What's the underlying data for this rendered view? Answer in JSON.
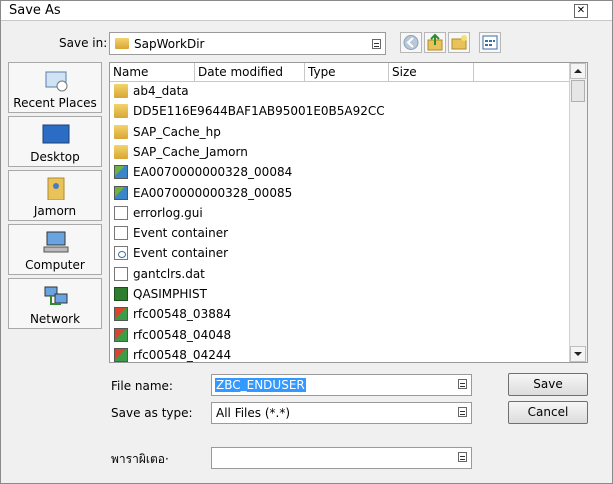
{
  "window": {
    "title": "Save As"
  },
  "save_in": {
    "label": "Save in:",
    "value": "SapWorkDir"
  },
  "toolbar": {
    "back_icon": "back-arrow-icon",
    "up_icon": "up-folder-icon",
    "new_folder_icon": "new-folder-icon",
    "view_icon": "view-menu-icon"
  },
  "places": [
    {
      "label": "Recent Places",
      "icon": "recent-places-icon"
    },
    {
      "label": "Desktop",
      "icon": "desktop-icon"
    },
    {
      "label": "Jamorn",
      "icon": "user-folder-icon"
    },
    {
      "label": "Computer",
      "icon": "computer-icon"
    },
    {
      "label": "Network",
      "icon": "network-icon"
    }
  ],
  "columns": [
    "Name",
    "Date modified",
    "Type",
    "Size"
  ],
  "files": [
    {
      "name": "ab4_data",
      "icon": "folder-icon"
    },
    {
      "name": "DD5E116E9644BAF1AB95001E0B5A92CC",
      "icon": "folder-icon"
    },
    {
      "name": "SAP_Cache_hp",
      "icon": "folder-icon"
    },
    {
      "name": "SAP_Cache_Jamorn",
      "icon": "folder-icon"
    },
    {
      "name": "EA0070000000328_00084",
      "icon": "image-file-icon"
    },
    {
      "name": "EA0070000000328_00085",
      "icon": "image-file-icon"
    },
    {
      "name": "errorlog.gui",
      "icon": "blank-file-icon"
    },
    {
      "name": "Event container",
      "icon": "blank-file-icon"
    },
    {
      "name": "Event container",
      "icon": "config-file-icon"
    },
    {
      "name": "gantclrs.dat",
      "icon": "blank-file-icon"
    },
    {
      "name": "QASIMPHIST",
      "icon": "excel-file-icon"
    },
    {
      "name": "rfc00548_03884",
      "icon": "rfc-file-icon"
    },
    {
      "name": "rfc00548_04048",
      "icon": "rfc-file-icon"
    },
    {
      "name": "rfc00548_04244",
      "icon": "rfc-file-icon"
    }
  ],
  "file_name": {
    "label": "File name:",
    "value": "ZBC_ENDUSER"
  },
  "save_as_type": {
    "label": "Save as type:",
    "value": "All Files (*.*)"
  },
  "encoding": {
    "label": "พาราผิเตอ·",
    "value": ""
  },
  "buttons": {
    "save": "Save",
    "cancel": "Cancel"
  },
  "colors": {
    "selection": "#3399ff",
    "accent_folder": "#e7b94a"
  }
}
